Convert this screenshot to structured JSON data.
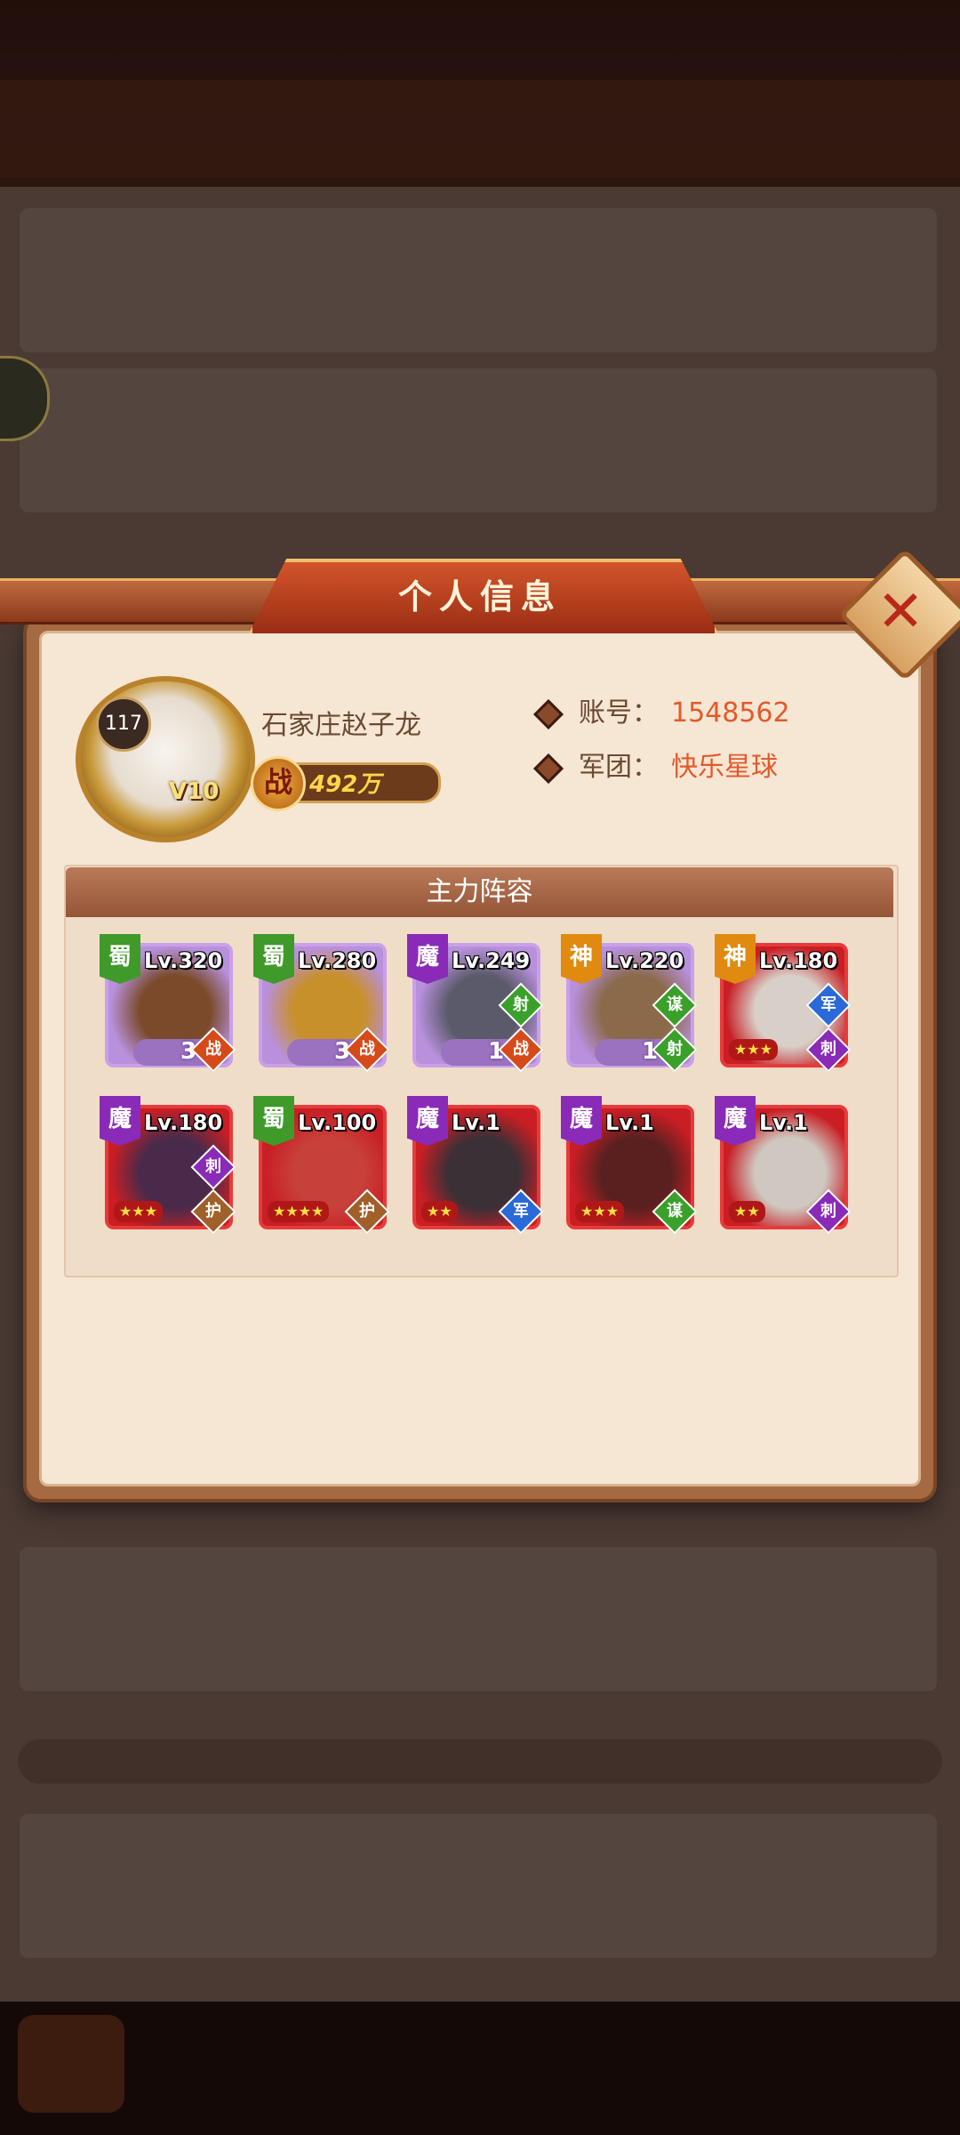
{
  "modal": {
    "title": "个人信息"
  },
  "player": {
    "avatar_level": "117",
    "vip": "V10",
    "name": "石家庄赵子龙",
    "power_icon": "战",
    "power": "492万",
    "account_label": "账号：",
    "account_value": "1548562",
    "legion_label": "军团：",
    "legion_value": "快乐星球"
  },
  "lineup": {
    "title": "主力阵容",
    "heroes": [
      {
        "faction": "蜀",
        "faction_color": "#3f9a2a",
        "level": "Lv.320",
        "frame": "purple",
        "role_top": "",
        "role_bottom": "战",
        "role_bottom_color": "#d64a1a",
        "star_count": "3",
        "stars": "",
        "portrait_color": "#7a4a2a"
      },
      {
        "faction": "蜀",
        "faction_color": "#3f9a2a",
        "level": "Lv.280",
        "frame": "purple",
        "role_top": "",
        "role_bottom": "战",
        "role_bottom_color": "#d64a1a",
        "star_count": "3",
        "stars": "",
        "portrait_color": "#c8902a"
      },
      {
        "faction": "魔",
        "faction_color": "#8a2ab8",
        "level": "Lv.249",
        "frame": "purple",
        "role_top": "射",
        "role_top_color": "#3aa02a",
        "role_bottom": "战",
        "role_bottom_color": "#d64a1a",
        "star_count": "1",
        "stars": "",
        "portrait_color": "#5a5a6a"
      },
      {
        "faction": "神",
        "faction_color": "#e08a10",
        "level": "Lv.220",
        "frame": "purple",
        "role_top": "谋",
        "role_top_color": "#3aa02a",
        "role_bottom": "射",
        "role_bottom_color": "#3aa02a",
        "star_count": "1",
        "stars": "",
        "portrait_color": "#8a6a4a"
      },
      {
        "faction": "神",
        "faction_color": "#e08a10",
        "level": "Lv.180",
        "frame": "red",
        "role_top": "军",
        "role_top_color": "#2a6ad8",
        "role_bottom": "刺",
        "role_bottom_color": "#8a2ab8",
        "star_count": "",
        "stars": "★★★",
        "portrait_color": "#d8d0c8"
      },
      {
        "faction": "魔",
        "faction_color": "#8a2ab8",
        "level": "Lv.180",
        "frame": "red",
        "role_top": "刺",
        "role_top_color": "#8a2ab8",
        "role_bottom": "护",
        "role_bottom_color": "#a0602a",
        "star_count": "",
        "stars": "★★★",
        "portrait_color": "#4a2a4a"
      },
      {
        "faction": "蜀",
        "faction_color": "#3f9a2a",
        "level": "Lv.100",
        "frame": "red",
        "role_top": "",
        "role_bottom": "护",
        "role_bottom_color": "#a0602a",
        "star_count": "",
        "stars": "★★★★",
        "portrait_color": "#c8403a"
      },
      {
        "faction": "魔",
        "faction_color": "#8a2ab8",
        "level": "Lv.1",
        "frame": "red",
        "role_top": "",
        "role_bottom": "军",
        "role_bottom_color": "#2a6ad8",
        "star_count": "",
        "stars": "★★",
        "portrait_color": "#3a3036"
      },
      {
        "faction": "魔",
        "faction_color": "#8a2ab8",
        "level": "Lv.1",
        "frame": "red",
        "role_top": "",
        "role_bottom": "谋",
        "role_bottom_color": "#3aa02a",
        "star_count": "",
        "stars": "★★★",
        "portrait_color": "#5a2020"
      },
      {
        "faction": "魔",
        "faction_color": "#8a2ab8",
        "level": "Lv.1",
        "frame": "red",
        "role_top": "",
        "role_bottom": "刺",
        "role_bottom_color": "#8a2ab8",
        "star_count": "",
        "stars": "★★",
        "portrait_color": "#cfc8c0"
      }
    ]
  },
  "icons": {
    "close": "close-icon",
    "diamond": "diamond-bullet-icon"
  }
}
